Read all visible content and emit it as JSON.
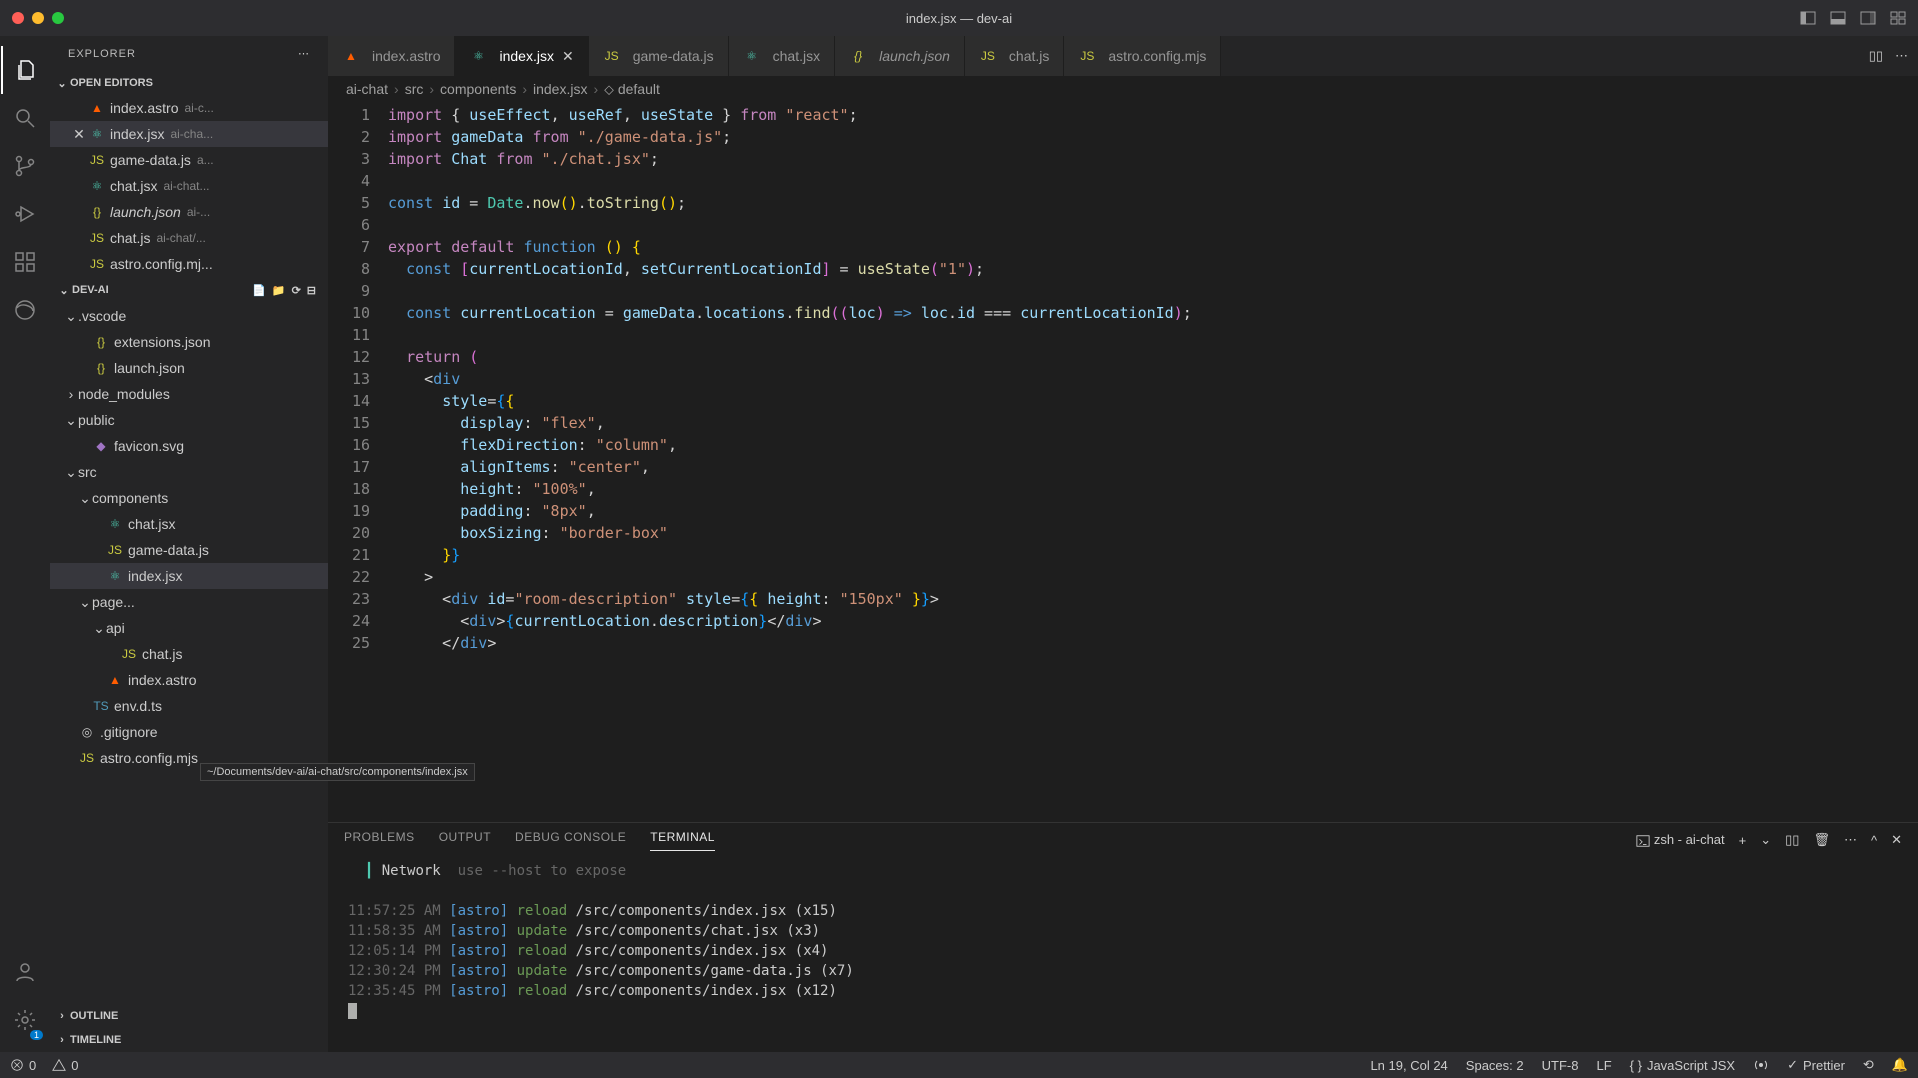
{
  "window": {
    "title": "index.jsx — dev-ai"
  },
  "activitybar": {
    "items": [
      "explorer",
      "search",
      "scm",
      "debug",
      "extensions",
      "remote"
    ],
    "bottom": [
      "account",
      "settings"
    ],
    "settings_badge": "1"
  },
  "explorer": {
    "title": "EXPLORER",
    "sections": {
      "open_editors": {
        "label": "OPEN EDITORS",
        "items": [
          {
            "name": "index.astro",
            "detail": "ai-c...",
            "icon": "astro"
          },
          {
            "name": "index.jsx",
            "detail": "ai-cha...",
            "icon": "react",
            "active": true
          },
          {
            "name": "game-data.js",
            "detail": "a...",
            "icon": "js"
          },
          {
            "name": "chat.jsx",
            "detail": "ai-chat...",
            "icon": "react"
          },
          {
            "name": "launch.json",
            "detail": "ai-...",
            "icon": "json",
            "italic": true
          },
          {
            "name": "chat.js",
            "detail": "ai-chat/...",
            "icon": "js"
          },
          {
            "name": "astro.config.mj...",
            "detail": "",
            "icon": "js"
          }
        ]
      },
      "project": {
        "label": "DEV-AI",
        "tree": [
          {
            "depth": 0,
            "kind": "folder",
            "open": true,
            "name": ".vscode"
          },
          {
            "depth": 1,
            "kind": "file",
            "icon": "json",
            "name": "extensions.json"
          },
          {
            "depth": 1,
            "kind": "file",
            "icon": "json",
            "name": "launch.json"
          },
          {
            "depth": 0,
            "kind": "folder",
            "open": false,
            "name": "node_modules"
          },
          {
            "depth": 0,
            "kind": "folder",
            "open": true,
            "name": "public"
          },
          {
            "depth": 1,
            "kind": "file",
            "icon": "svg",
            "name": "favicon.svg"
          },
          {
            "depth": 0,
            "kind": "folder",
            "open": true,
            "name": "src"
          },
          {
            "depth": 1,
            "kind": "folder",
            "open": true,
            "name": "components"
          },
          {
            "depth": 2,
            "kind": "file",
            "icon": "react",
            "name": "chat.jsx"
          },
          {
            "depth": 2,
            "kind": "file",
            "icon": "js",
            "name": "game-data.js"
          },
          {
            "depth": 2,
            "kind": "file",
            "icon": "react",
            "name": "index.jsx",
            "selected": true
          },
          {
            "depth": 1,
            "kind": "folder",
            "open": true,
            "name": "page..."
          },
          {
            "depth": 2,
            "kind": "folder",
            "open": true,
            "name": "api"
          },
          {
            "depth": 3,
            "kind": "file",
            "icon": "js",
            "name": "chat.js"
          },
          {
            "depth": 2,
            "kind": "file",
            "icon": "astro",
            "name": "index.astro"
          },
          {
            "depth": 1,
            "kind": "file",
            "icon": "ts",
            "name": "env.d.ts"
          },
          {
            "depth": 0,
            "kind": "file",
            "icon": "",
            "name": ".gitignore"
          },
          {
            "depth": 0,
            "kind": "file",
            "icon": "js",
            "name": "astro.config.mjs"
          }
        ]
      },
      "outline": {
        "label": "OUTLINE"
      },
      "timeline": {
        "label": "TIMELINE"
      }
    },
    "tooltip": "~/Documents/dev-ai/ai-chat/src/components/index.jsx"
  },
  "tabs": [
    {
      "icon": "astro",
      "label": "index.astro"
    },
    {
      "icon": "react",
      "label": "index.jsx",
      "active": true,
      "closeable": true
    },
    {
      "icon": "js",
      "label": "game-data.js"
    },
    {
      "icon": "react",
      "label": "chat.jsx"
    },
    {
      "icon": "json",
      "label": "launch.json",
      "preview": true
    },
    {
      "icon": "js",
      "label": "chat.js"
    },
    {
      "icon": "js",
      "label": "astro.config.mjs"
    }
  ],
  "breadcrumbs": [
    "ai-chat",
    "src",
    "components",
    "index.jsx",
    "default"
  ],
  "code_lines": [
    [
      [
        "tk-keyword",
        "import"
      ],
      [
        "tk-punct",
        " { "
      ],
      [
        "tk-var",
        "useEffect"
      ],
      [
        "tk-punct",
        ", "
      ],
      [
        "tk-var",
        "useRef"
      ],
      [
        "tk-punct",
        ", "
      ],
      [
        "tk-var",
        "useState"
      ],
      [
        "tk-punct",
        " } "
      ],
      [
        "tk-keyword",
        "from"
      ],
      [
        "tk-punct",
        " "
      ],
      [
        "tk-string",
        "\"react\""
      ],
      [
        "tk-punct",
        ";"
      ]
    ],
    [
      [
        "tk-keyword",
        "import"
      ],
      [
        "tk-punct",
        " "
      ],
      [
        "tk-var",
        "gameData"
      ],
      [
        "tk-punct",
        " "
      ],
      [
        "tk-keyword",
        "from"
      ],
      [
        "tk-punct",
        " "
      ],
      [
        "tk-string",
        "\"./game-data.js\""
      ],
      [
        "tk-punct",
        ";"
      ]
    ],
    [
      [
        "tk-keyword",
        "import"
      ],
      [
        "tk-punct",
        " "
      ],
      [
        "tk-var",
        "Chat"
      ],
      [
        "tk-punct",
        " "
      ],
      [
        "tk-keyword",
        "from"
      ],
      [
        "tk-punct",
        " "
      ],
      [
        "tk-string",
        "\"./chat.jsx\""
      ],
      [
        "tk-punct",
        ";"
      ]
    ],
    [
      [
        "",
        ""
      ]
    ],
    [
      [
        "tk-const",
        "const"
      ],
      [
        "tk-punct",
        " "
      ],
      [
        "tk-var",
        "id"
      ],
      [
        "tk-punct",
        " = "
      ],
      [
        "tk-type",
        "Date"
      ],
      [
        "tk-punct",
        "."
      ],
      [
        "tk-func",
        "now"
      ],
      [
        "tk-brace",
        "()"
      ],
      [
        "tk-punct",
        "."
      ],
      [
        "tk-func",
        "toString"
      ],
      [
        "tk-brace",
        "()"
      ],
      [
        "tk-punct",
        ";"
      ]
    ],
    [
      [
        "",
        ""
      ]
    ],
    [
      [
        "tk-keyword",
        "export"
      ],
      [
        "tk-punct",
        " "
      ],
      [
        "tk-keyword",
        "default"
      ],
      [
        "tk-punct",
        " "
      ],
      [
        "tk-const",
        "function"
      ],
      [
        "tk-punct",
        " "
      ],
      [
        "tk-brace",
        "()"
      ],
      [
        "tk-punct",
        " "
      ],
      [
        "tk-brace",
        "{"
      ]
    ],
    [
      [
        "tk-punct",
        "  "
      ],
      [
        "tk-const",
        "const"
      ],
      [
        "tk-punct",
        " "
      ],
      [
        "tk-brace2",
        "["
      ],
      [
        "tk-var",
        "currentLocationId"
      ],
      [
        "tk-punct",
        ", "
      ],
      [
        "tk-var",
        "setCurrentLocationId"
      ],
      [
        "tk-brace2",
        "]"
      ],
      [
        "tk-punct",
        " = "
      ],
      [
        "tk-func",
        "useState"
      ],
      [
        "tk-brace2",
        "("
      ],
      [
        "tk-string",
        "\"1\""
      ],
      [
        "tk-brace2",
        ")"
      ],
      [
        "tk-punct",
        ";"
      ]
    ],
    [
      [
        "",
        ""
      ]
    ],
    [
      [
        "tk-punct",
        "  "
      ],
      [
        "tk-const",
        "const"
      ],
      [
        "tk-punct",
        " "
      ],
      [
        "tk-var",
        "currentLocation"
      ],
      [
        "tk-punct",
        " = "
      ],
      [
        "tk-var",
        "gameData"
      ],
      [
        "tk-punct",
        "."
      ],
      [
        "tk-var",
        "locations"
      ],
      [
        "tk-punct",
        "."
      ],
      [
        "tk-func",
        "find"
      ],
      [
        "tk-brace2",
        "(("
      ],
      [
        "tk-var",
        "loc"
      ],
      [
        "tk-brace2",
        ")"
      ],
      [
        "tk-punct",
        " "
      ],
      [
        "tk-const",
        "=>"
      ],
      [
        "tk-punct",
        " "
      ],
      [
        "tk-var",
        "loc"
      ],
      [
        "tk-punct",
        "."
      ],
      [
        "tk-var",
        "id"
      ],
      [
        "tk-punct",
        " === "
      ],
      [
        "tk-var",
        "currentLocationId"
      ],
      [
        "tk-brace2",
        ")"
      ],
      [
        "tk-punct",
        ";"
      ]
    ],
    [
      [
        "",
        ""
      ]
    ],
    [
      [
        "tk-punct",
        "  "
      ],
      [
        "tk-keyword",
        "return"
      ],
      [
        "tk-punct",
        " "
      ],
      [
        "tk-brace2",
        "("
      ]
    ],
    [
      [
        "tk-punct",
        "    <"
      ],
      [
        "tk-tag",
        "div"
      ]
    ],
    [
      [
        "tk-punct",
        "      "
      ],
      [
        "tk-attr",
        "style"
      ],
      [
        "tk-punct",
        "="
      ],
      [
        "tk-brace3",
        "{"
      ],
      [
        "tk-brace",
        "{"
      ]
    ],
    [
      [
        "tk-punct",
        "        "
      ],
      [
        "tk-var",
        "display"
      ],
      [
        "tk-punct",
        ": "
      ],
      [
        "tk-string",
        "\"flex\""
      ],
      [
        "tk-punct",
        ","
      ]
    ],
    [
      [
        "tk-punct",
        "        "
      ],
      [
        "tk-var",
        "flexDirection"
      ],
      [
        "tk-punct",
        ": "
      ],
      [
        "tk-string",
        "\"column\""
      ],
      [
        "tk-punct",
        ","
      ]
    ],
    [
      [
        "tk-punct",
        "        "
      ],
      [
        "tk-var",
        "alignItems"
      ],
      [
        "tk-punct",
        ": "
      ],
      [
        "tk-string",
        "\"center\""
      ],
      [
        "tk-punct",
        ","
      ]
    ],
    [
      [
        "tk-punct",
        "        "
      ],
      [
        "tk-var",
        "height"
      ],
      [
        "tk-punct",
        ": "
      ],
      [
        "tk-string",
        "\"100%\""
      ],
      [
        "tk-punct",
        ","
      ]
    ],
    [
      [
        "tk-punct",
        "        "
      ],
      [
        "tk-var",
        "padding"
      ],
      [
        "tk-punct",
        ": "
      ],
      [
        "tk-string",
        "\"8px\""
      ],
      [
        "tk-punct",
        ","
      ]
    ],
    [
      [
        "tk-punct",
        "        "
      ],
      [
        "tk-var",
        "boxSizing"
      ],
      [
        "tk-punct",
        ": "
      ],
      [
        "tk-string",
        "\"border-box\""
      ]
    ],
    [
      [
        "tk-punct",
        "      "
      ],
      [
        "tk-brace",
        "}"
      ],
      [
        "tk-brace3",
        "}"
      ]
    ],
    [
      [
        "tk-punct",
        "    >"
      ]
    ],
    [
      [
        "tk-punct",
        "      <"
      ],
      [
        "tk-tag",
        "div"
      ],
      [
        "tk-punct",
        " "
      ],
      [
        "tk-attr",
        "id"
      ],
      [
        "tk-punct",
        "="
      ],
      [
        "tk-string",
        "\"room-description\""
      ],
      [
        "tk-punct",
        " "
      ],
      [
        "tk-attr",
        "style"
      ],
      [
        "tk-punct",
        "="
      ],
      [
        "tk-brace3",
        "{"
      ],
      [
        "tk-brace",
        "{"
      ],
      [
        "tk-punct",
        " "
      ],
      [
        "tk-var",
        "height"
      ],
      [
        "tk-punct",
        ": "
      ],
      [
        "tk-string",
        "\"150px\""
      ],
      [
        "tk-punct",
        " "
      ],
      [
        "tk-brace",
        "}"
      ],
      [
        "tk-brace3",
        "}"
      ],
      [
        "tk-punct",
        ">"
      ]
    ],
    [
      [
        "tk-punct",
        "        <"
      ],
      [
        "tk-tag",
        "div"
      ],
      [
        "tk-punct",
        ">"
      ],
      [
        "tk-brace3",
        "{"
      ],
      [
        "tk-var",
        "currentLocation"
      ],
      [
        "tk-punct",
        "."
      ],
      [
        "tk-var",
        "description"
      ],
      [
        "tk-brace3",
        "}"
      ],
      [
        "tk-punct",
        "</"
      ],
      [
        "tk-tag",
        "div"
      ],
      [
        "tk-punct",
        ">"
      ]
    ],
    [
      [
        "tk-punct",
        "      </"
      ],
      [
        "tk-tag",
        "div"
      ],
      [
        "tk-punct",
        ">"
      ]
    ]
  ],
  "line_start": 1,
  "line_end": 25,
  "panel": {
    "tabs": [
      "PROBLEMS",
      "OUTPUT",
      "DEBUG CONSOLE",
      "TERMINAL"
    ],
    "active_tab": "TERMINAL",
    "terminal_label": "zsh - ai-chat",
    "network_label": "Network",
    "network_hint": "use --host to expose",
    "lines": [
      {
        "time": "11:57:25 AM",
        "tag": "[astro]",
        "action": "reload",
        "path": "/src/components/index.jsx",
        "count": "(x15)"
      },
      {
        "time": "11:58:35 AM",
        "tag": "[astro]",
        "action": "update",
        "path": "/src/components/chat.jsx",
        "count": "(x3)"
      },
      {
        "time": "12:05:14 PM",
        "tag": "[astro]",
        "action": "reload",
        "path": "/src/components/index.jsx",
        "count": "(x4)"
      },
      {
        "time": "12:30:24 PM",
        "tag": "[astro]",
        "action": "update",
        "path": "/src/components/game-data.js",
        "count": "(x7)"
      },
      {
        "time": "12:35:45 PM",
        "tag": "[astro]",
        "action": "reload",
        "path": "/src/components/index.jsx",
        "count": "(x12)"
      }
    ]
  },
  "statusbar": {
    "errors": "0",
    "warnings": "0",
    "cursor": "Ln 19, Col 24",
    "spaces": "Spaces: 2",
    "encoding": "UTF-8",
    "eol": "LF",
    "lang": "JavaScript JSX",
    "prettier": "Prettier"
  }
}
